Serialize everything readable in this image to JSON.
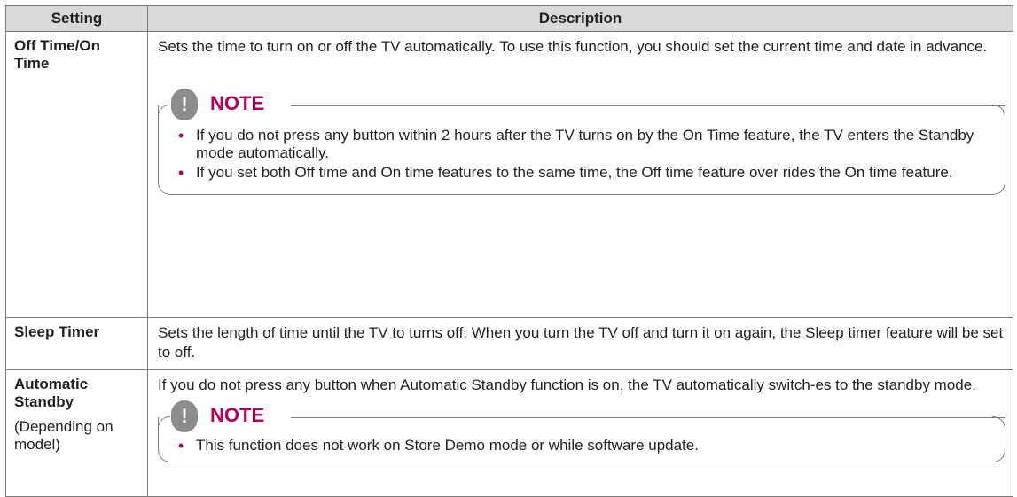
{
  "table": {
    "headers": [
      "Setting",
      "Description"
    ],
    "rows": [
      {
        "setting": "Off Time/On Time",
        "description": "Sets the time to turn on or off the TV automatically. To use this function, you should set the current time and date in advance.",
        "note": {
          "title": "NOTE",
          "items": [
            "If you do not press any button within 2 hours after the TV turns on by the On Time feature, the TV enters the Standby mode automatically.",
            "If you set both Off time and On time features to the same time, the Off time feature over rides the On time feature."
          ]
        }
      },
      {
        "setting": "Sleep Timer",
        "description": "Sets the length of time until the TV to turns off. When you turn the TV off and turn it on again, the Sleep timer feature will be set to off."
      },
      {
        "setting": "Automatic Standby",
        "setting_sub": "(Depending on model)",
        "description": "If you do not press any button when Automatic Standby function is on, the TV automatically switch-es to the standby mode.",
        "note": {
          "title": "NOTE",
          "items": [
            "This function does not work on Store Demo mode or while software update."
          ]
        }
      }
    ]
  },
  "icons": {
    "note_icon": "exclamation-icon",
    "note_icon_glyph": "!",
    "bullet_glyph": "•"
  },
  "colors": {
    "note_title": "#b5005a",
    "header_bg": "#d9d9d9",
    "note_icon_bg": "#8c8c8c"
  }
}
